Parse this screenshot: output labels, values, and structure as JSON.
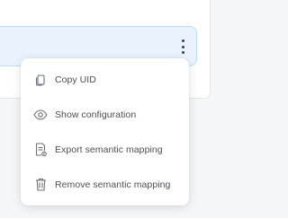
{
  "menu": {
    "items": [
      {
        "label": "Copy UID",
        "icon": "copy-icon"
      },
      {
        "label": "Show configuration",
        "icon": "eye-icon"
      },
      {
        "label": "Export semantic mapping",
        "icon": "export-document-icon"
      },
      {
        "label": "Remove semantic mapping",
        "icon": "trash-icon"
      }
    ]
  },
  "colors": {
    "row_background": "#e8f3fd",
    "row_border": "#b9dcf6",
    "menu_text": "#4a4f56",
    "icon": "#6b7079"
  }
}
